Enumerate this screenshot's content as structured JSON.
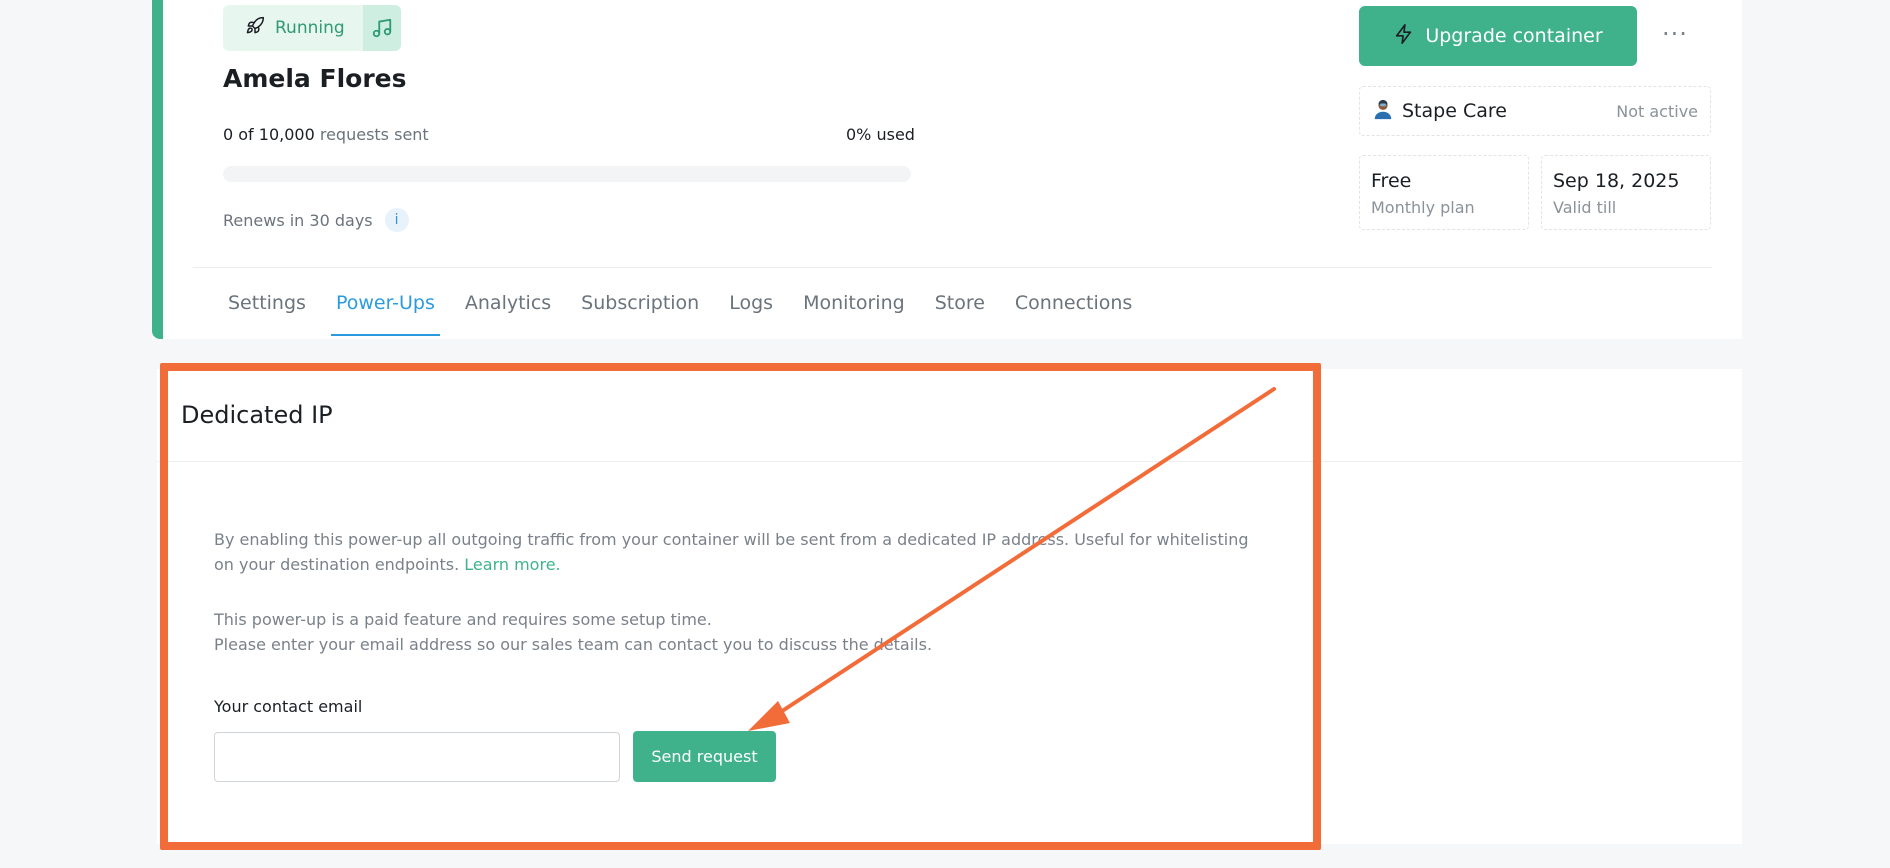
{
  "container": {
    "status": "Running",
    "name": "Amela Flores",
    "requests_count": "0 of 10,000",
    "requests_suffix": "requests sent",
    "usage_percent_text": "0% used",
    "usage_fraction": 0,
    "renews_text": "Renews in 30 days",
    "info_glyph": "i",
    "upgrade_label": "Upgrade container",
    "more_glyph": "···",
    "care_label": "Stape Care",
    "care_status": "Not active",
    "plan_name": "Free",
    "plan_caption": "Monthly plan",
    "valid_date": "Sep 18, 2025",
    "valid_caption": "Valid till"
  },
  "tabs": [
    {
      "label": "Settings",
      "active": false
    },
    {
      "label": "Power-Ups",
      "active": true
    },
    {
      "label": "Analytics",
      "active": false
    },
    {
      "label": "Subscription",
      "active": false
    },
    {
      "label": "Logs",
      "active": false
    },
    {
      "label": "Monitoring",
      "active": false
    },
    {
      "label": "Store",
      "active": false
    },
    {
      "label": "Connections",
      "active": false
    }
  ],
  "powerup": {
    "title": "Dedicated IP",
    "description": "By enabling this power-up all outgoing traffic from your container will be sent from a dedicated IP address. Useful for whitelisting on your destination endpoints.",
    "learn_more": "Learn more.",
    "note_line1": "This power-up is a paid feature and requires some setup time.",
    "note_line2": "Please enter your email address so our sales team can contact you to discuss the details.",
    "email_label": "Your contact email",
    "email_value": "",
    "send_label": "Send request"
  },
  "colors": {
    "brand_green": "#3fb28b",
    "active_tab_blue": "#2b9be0",
    "annotation_orange": "#f26c3a"
  },
  "icons": {
    "status": "rocket-icon",
    "status_side": "music-note-icon",
    "upgrade": "lightning-icon",
    "care": "person-icon",
    "more": "ellipsis-icon",
    "info": "info-icon"
  }
}
